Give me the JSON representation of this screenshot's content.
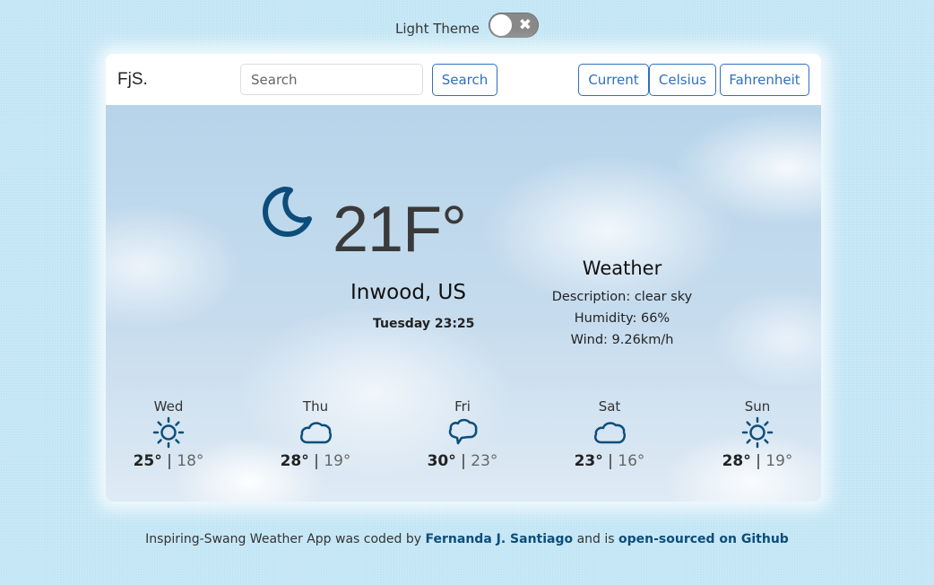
{
  "theme_toggle": {
    "label": "Light Theme",
    "off_glyph": "✖"
  },
  "navbar": {
    "brand": "FjS.",
    "search_placeholder": "Search",
    "search_button": "Search",
    "current_button": "Current",
    "celsius_button": "Celsius",
    "fahrenheit_button": "Fahrenheit"
  },
  "current": {
    "icon": "moon-icon",
    "temperature": "21F°",
    "city": "Inwood, US",
    "datetime": "Tuesday 23:25"
  },
  "details": {
    "title": "Weather",
    "description": "Description: clear sky",
    "humidity": "Humidity: 66%",
    "wind": "Wind: 9.26km/h"
  },
  "forecast": [
    {
      "day": "Wed",
      "icon": "sun-icon",
      "max": "25°",
      "min": "18°"
    },
    {
      "day": "Thu",
      "icon": "cloud-icon",
      "max": "28°",
      "min": "19°"
    },
    {
      "day": "Fri",
      "icon": "chat-cloud-icon",
      "max": "30°",
      "min": "23°"
    },
    {
      "day": "Sat",
      "icon": "cloud-icon",
      "max": "23°",
      "min": "16°"
    },
    {
      "day": "Sun",
      "icon": "sun-icon",
      "max": "28°",
      "min": "19°"
    }
  ],
  "footer": {
    "prefix": "Inspiring-Swang Weather App was coded by ",
    "author": "Fernanda J. Santiago",
    "middle": " and is ",
    "repo_link": "open-sourced on Github"
  },
  "colors": {
    "accent": "#2f6fbf",
    "icon": "#0d4d7a",
    "page_bg": "#c9e9f7"
  }
}
